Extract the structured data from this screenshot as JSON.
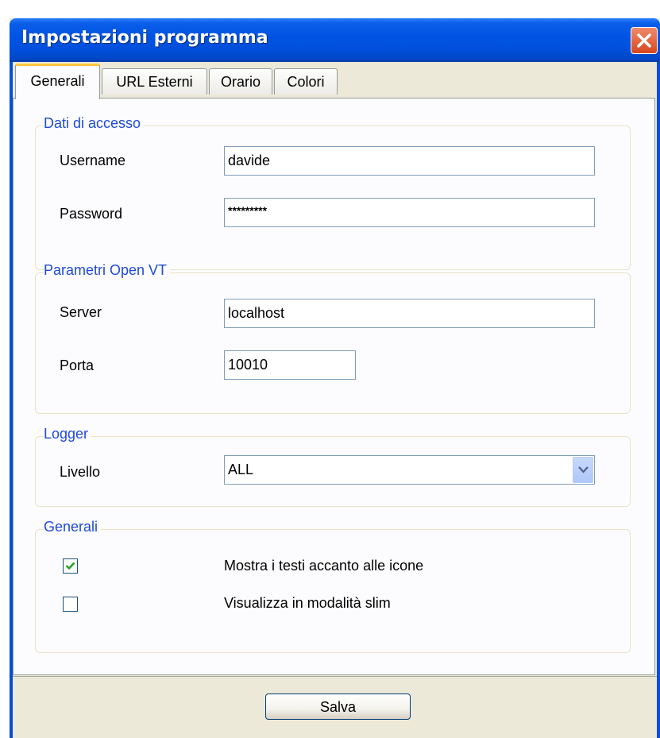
{
  "window": {
    "title": "Impostazioni programma"
  },
  "tabs": [
    {
      "label": "Generali",
      "active": true
    },
    {
      "label": "URL Esterni",
      "active": false
    },
    {
      "label": "Orario",
      "active": false
    },
    {
      "label": "Colori",
      "active": false
    }
  ],
  "access": {
    "legend": "Dati di accesso",
    "username_label": "Username",
    "username_value": "davide",
    "password_label": "Password",
    "password_value": "*********"
  },
  "openvt": {
    "legend": "Parametri Open VT",
    "server_label": "Server",
    "server_value": "localhost",
    "port_label": "Porta",
    "port_value": "10010"
  },
  "logger": {
    "legend": "Logger",
    "level_label": "Livello",
    "level_value": "ALL"
  },
  "general": {
    "legend": "Generali",
    "options": [
      {
        "label": "Mostra i testi accanto alle icone",
        "checked": true
      },
      {
        "label": "Visualizza in modalità slim",
        "checked": false
      }
    ]
  },
  "footer": {
    "save_label": "Salva"
  },
  "colors": {
    "accent": "#0054e3",
    "legend": "#1e4ad8",
    "tab_highlight": "#ffc83c"
  }
}
